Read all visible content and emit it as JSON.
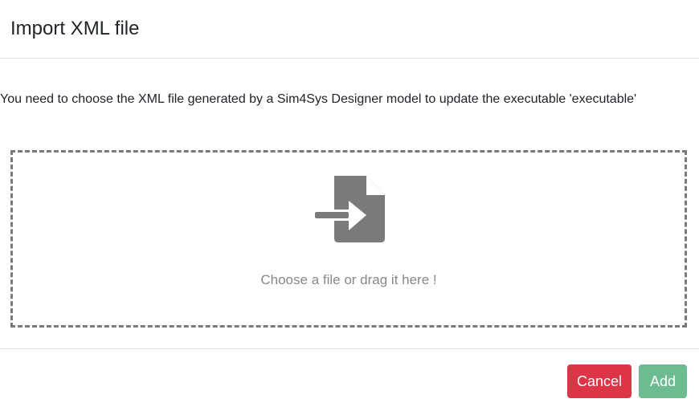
{
  "dialog": {
    "title": "Import XML file",
    "description": "You need to choose the XML file generated by a Sim4Sys Designer model to update the executable 'executable'"
  },
  "dropzone": {
    "icon": "file-import-icon",
    "label": "Choose a file or drag it here !"
  },
  "footer": {
    "cancel_label": "Cancel",
    "add_label": "Add"
  },
  "colors": {
    "cancel": "#dc3545",
    "add": "#6dbb91",
    "icon": "#7a7a7a",
    "dropzone_border": "#7a7a7a"
  }
}
